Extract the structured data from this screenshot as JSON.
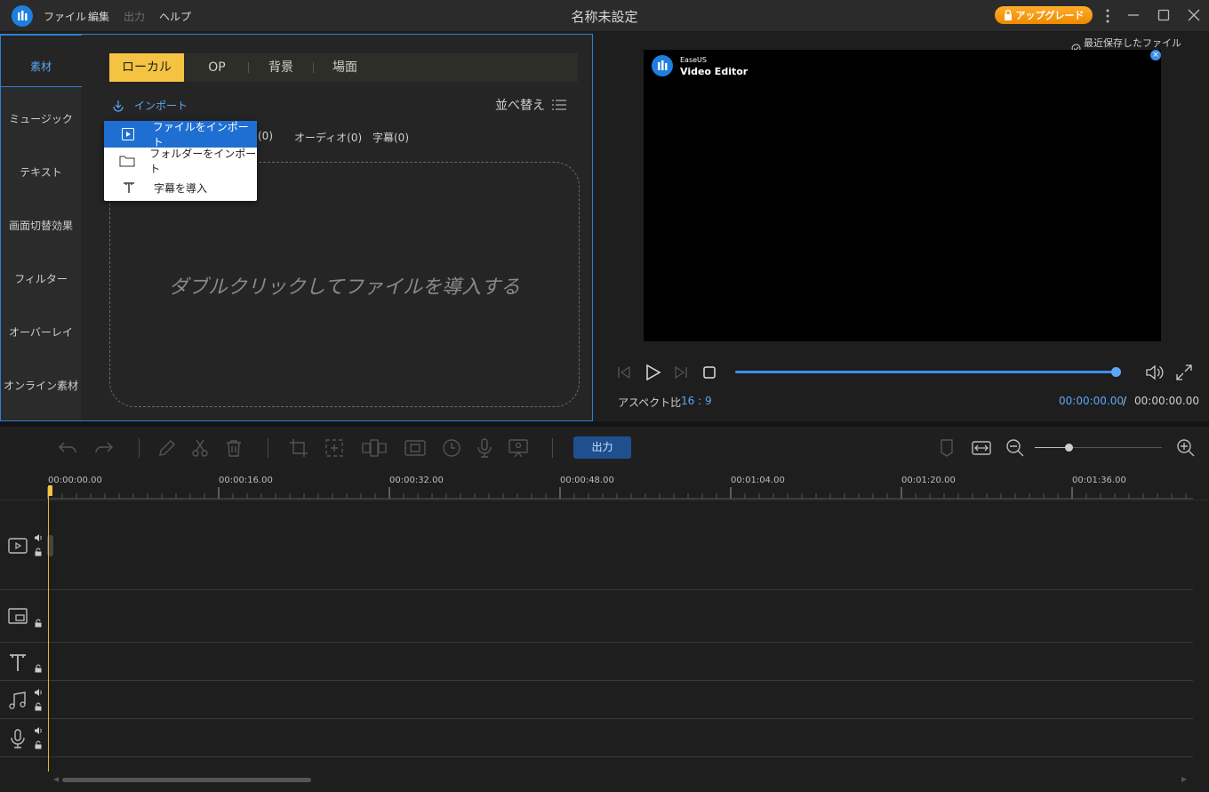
{
  "app": {
    "window_title": "名称未設定",
    "menu": [
      "ファイル",
      "編集",
      "出力",
      "ヘルプ"
    ],
    "upgrade_label": "アップグレード"
  },
  "left_panel": {
    "categories": [
      "素材",
      "ミュージック",
      "テキスト",
      "画面切替効果",
      "フィルター",
      "オーバーレイ",
      "オンライン素材"
    ],
    "active_category": "素材",
    "media_tabs": [
      "ローカル",
      "OP",
      "背景",
      "場面"
    ],
    "active_tab": "ローカル",
    "import_label": "インポート",
    "sort_label": "並べ替え",
    "filter_tabs": [
      "(0)",
      "オーディオ(0)",
      "字幕(0)"
    ],
    "drop_hint": "ダブルクリックしてファイルを導入する",
    "import_menu": [
      {
        "label": "ファイルをインポート",
        "icon": "video-file-icon",
        "active": true
      },
      {
        "label": "フォルダーをインポート",
        "icon": "folder-icon",
        "active": false
      },
      {
        "label": "字幕を導入",
        "icon": "text-icon",
        "active": false
      }
    ]
  },
  "preview": {
    "saved_note": "最近保存したファイル 15:15",
    "watermark_small": "EaseUS",
    "watermark_big": "Video Editor",
    "aspect_label": "アスペクト比",
    "aspect_value": "16 : 9",
    "time_current": "00:00:00.00",
    "time_separator": "/",
    "time_total": "00:00:00.00"
  },
  "toolbar": {
    "export_label": "出力"
  },
  "timeline": {
    "ruler_labels": [
      "00:00:00.00",
      "00:00:16.00",
      "00:00:32.00",
      "00:00:48.00",
      "00:01:04.00",
      "00:01:20.00",
      "00:01:36.00"
    ],
    "tracks": [
      "video-track",
      "overlay-track",
      "text-track",
      "music-track",
      "voice-track"
    ]
  },
  "colors": {
    "accent_blue": "#2f80d0",
    "tab_active": "#f5c342",
    "upgrade": "#f59a12",
    "playhead": "#e6b53a"
  }
}
